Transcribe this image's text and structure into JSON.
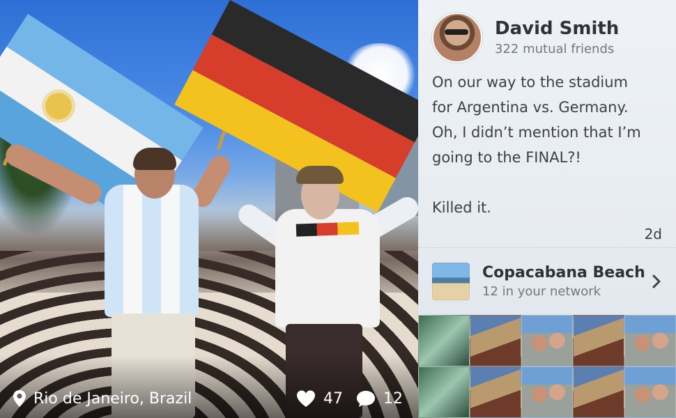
{
  "photo": {
    "location": "Rio de Janeiro, Brazil",
    "likes": "47",
    "comments": "12"
  },
  "author": {
    "name": "David Smith",
    "mutual": "322 mutual friends"
  },
  "post": {
    "text": "On our way to the stadium\nfor Argentina vs. Germany.\nOh, I didn’t mention that I’m\ngoing to the FINAL?!\n\nKilled it.",
    "time": "2d"
  },
  "place": {
    "name": "Copacabana Beach",
    "network": "12 in your network"
  },
  "icons": {
    "location": "location-pin-icon",
    "likes": "heart-icon",
    "comments": "comment-bubble-icon",
    "chevron": "chevron-right-icon"
  },
  "colors": {
    "text_primary": "#2f3338",
    "text_secondary": "#707780",
    "panel_bg": "#eef2f6"
  }
}
